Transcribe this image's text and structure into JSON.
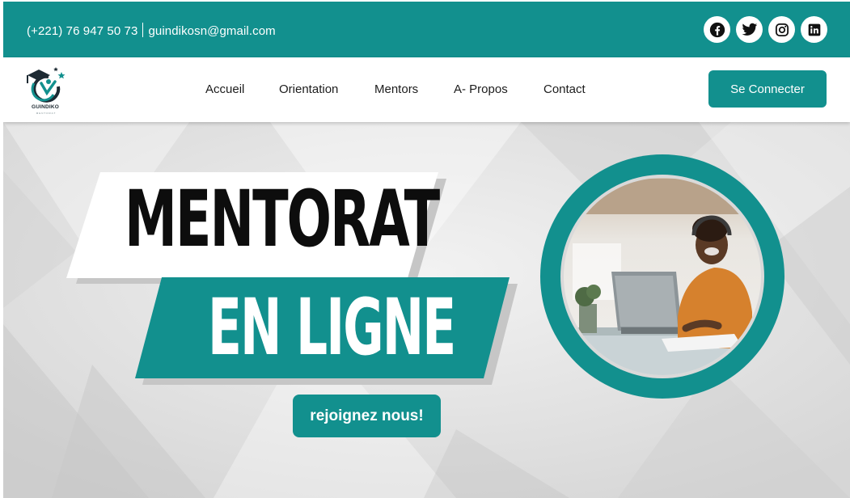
{
  "topbar": {
    "phone": "(+221) 76 947 50 73",
    "email": "guindikosn@gmail.com",
    "socials": [
      {
        "name": "facebook-icon"
      },
      {
        "name": "twitter-icon"
      },
      {
        "name": "instagram-icon"
      },
      {
        "name": "linkedin-icon"
      }
    ]
  },
  "brand": {
    "name": "GUINDIKO",
    "tagline": "MENTORAT"
  },
  "nav": {
    "items": [
      "Accueil",
      "Orientation",
      "Mentors",
      "A- Propos",
      "Contact"
    ],
    "login_label": "Se Connecter"
  },
  "hero": {
    "title_line1": "MENTORAT",
    "title_line2": "EN LIGNE",
    "cta_label": "rejoignez nous!"
  },
  "colors": {
    "accent": "#12908e",
    "text_dark": "#0d0d0d",
    "hero_bg": "#e3e3e3"
  }
}
